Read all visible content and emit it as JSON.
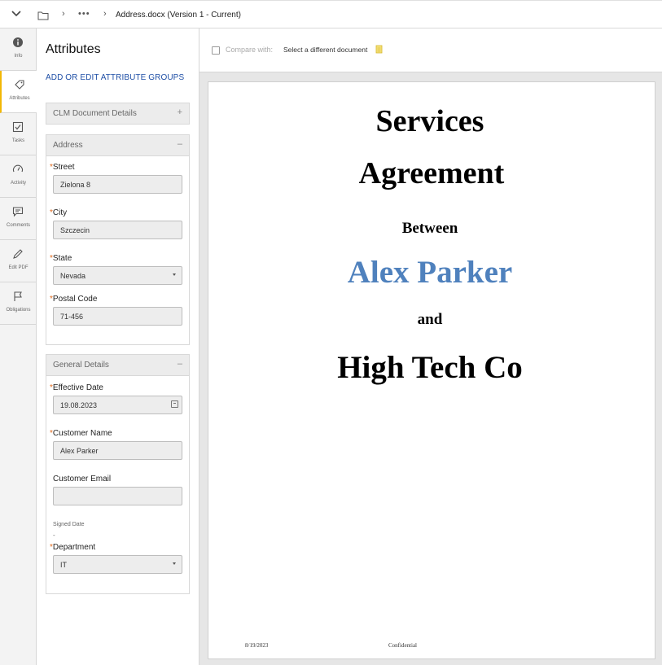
{
  "topbar": {
    "breadcrumb_ellipsis": "•••",
    "document_title": "Address.docx (Version 1 - Current)"
  },
  "rail": {
    "items": [
      {
        "label": "Info",
        "icon": "info-icon"
      },
      {
        "label": "Attributes",
        "icon": "tag-icon"
      },
      {
        "label": "Tasks",
        "icon": "checkbox-icon"
      },
      {
        "label": "Activity",
        "icon": "gauge-icon"
      },
      {
        "label": "Comments",
        "icon": "comment-icon"
      },
      {
        "label": "Edit PDF",
        "icon": "pencil-icon"
      },
      {
        "label": "Obligations",
        "icon": "flag-icon"
      }
    ],
    "active_accent": "#f2b705"
  },
  "panel": {
    "title": "Attributes",
    "add_link": "ADD OR EDIT ATTRIBUTE GROUPS",
    "groups": [
      {
        "title": "CLM Document Details",
        "toggle": "+"
      },
      {
        "title": "Address",
        "toggle": "–",
        "fields": [
          {
            "label": "Street",
            "value": "Zielona 8",
            "required": "*"
          },
          {
            "label": "City",
            "value": "Szczecin",
            "required": "*"
          },
          {
            "label": "State",
            "value": "Nevada",
            "required": "*"
          },
          {
            "label": "Postal Code",
            "value": "71-456",
            "required": "*"
          }
        ]
      },
      {
        "title": "General Details",
        "toggle": "–",
        "fields": [
          {
            "label": "Effective Date",
            "value": "19.08.2023",
            "required": "*"
          },
          {
            "label": "Customer Name",
            "value": "Alex Parker",
            "required": "*"
          },
          {
            "label": "Customer Email",
            "value": ""
          },
          {
            "label": "Signed Date",
            "value": "-"
          },
          {
            "label": "Department",
            "value": "IT",
            "required": "*"
          }
        ]
      }
    ]
  },
  "compare": {
    "label": "Compare with:",
    "select_text": "Select a different document"
  },
  "document": {
    "line1": "Services",
    "line2": "Agreement",
    "between": "Between",
    "party1": "Alex Parker",
    "and": "and",
    "party2": "High Tech Co",
    "footer_date": "8/19/2023",
    "footer_note": "Confidential",
    "party1_color": "#4f81bd"
  }
}
